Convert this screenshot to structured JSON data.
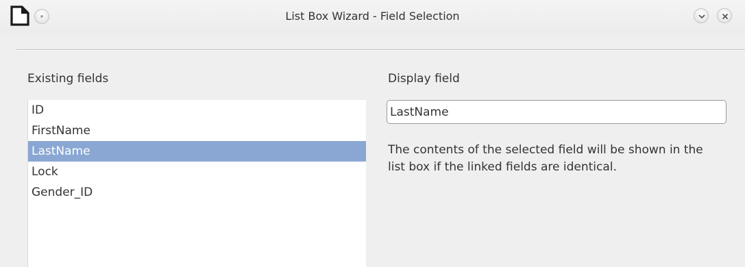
{
  "window": {
    "title": "List Box Wizard - Field Selection",
    "app_icon": "document-icon",
    "buttons": [
      "menu-button",
      "minimize-button",
      "close-button"
    ]
  },
  "existing_fields": {
    "label": "Existing fields",
    "items": [
      "ID",
      "FirstName",
      "LastName",
      "Lock",
      "Gender_ID"
    ],
    "selected": "LastName"
  },
  "display_field": {
    "label": "Display field",
    "value": "LastName",
    "info": "The contents of the selected field will be shown in the list box if the linked fields are identical."
  },
  "colors": {
    "selection": "#89a7d2",
    "background": "#efefef"
  }
}
